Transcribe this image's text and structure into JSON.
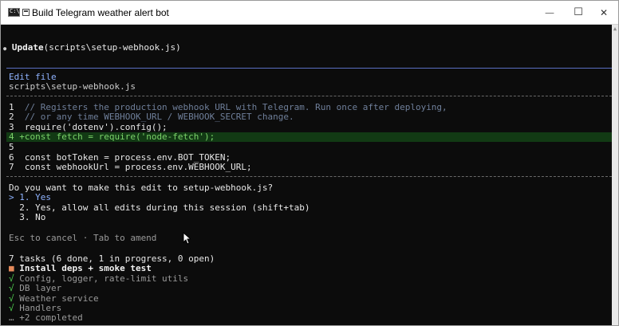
{
  "window": {
    "title": "Build Telegram weather alert bot",
    "app_icon_text": "C:\\",
    "controls": {
      "minimize": "—",
      "maximize": "☐",
      "close": "✕"
    }
  },
  "terminal": {
    "update_bullet": "●",
    "update_command": "Update",
    "update_arg": "(scripts\\setup-webhook.js)",
    "edit_header": "Edit file",
    "edit_path": "scripts\\setup-webhook.js",
    "code_lines": [
      {
        "num": "1",
        "marker": " ",
        "text": "// Registers the production webhook URL with Telegram. Run once after deploying,",
        "kind": "comment"
      },
      {
        "num": "2",
        "marker": " ",
        "text": "// or any time WEBHOOK_URL / WEBHOOK_SECRET change.",
        "kind": "comment"
      },
      {
        "num": "3",
        "marker": " ",
        "text": "require('dotenv').config();",
        "kind": "code"
      },
      {
        "num": "4",
        "marker": "+",
        "text": "const fetch = require('node-fetch');",
        "kind": "added"
      },
      {
        "num": "5",
        "marker": " ",
        "text": "",
        "kind": "code"
      },
      {
        "num": "6",
        "marker": " ",
        "text": "const botToken = process.env.BOT_TOKEN;",
        "kind": "code"
      },
      {
        "num": "7",
        "marker": " ",
        "text": "const webhookUrl = process.env.WEBHOOK_URL;",
        "kind": "code"
      }
    ],
    "question": "Do you want to make this edit to setup-webhook.js?",
    "options": [
      {
        "prefix": "> ",
        "label": "1. Yes",
        "selected": true
      },
      {
        "prefix": "  ",
        "label": "2. Yes, allow all edits during this session (shift+tab)",
        "selected": false
      },
      {
        "prefix": "  ",
        "label": "3. No",
        "selected": false
      }
    ],
    "hint": "Esc to cancel · Tab to amend",
    "tasks_summary": "7 tasks (6 done, 1 in progress, 0 open)",
    "tasks": [
      {
        "mark": "■",
        "label": "Install deps + smoke test",
        "status": "in_progress"
      },
      {
        "mark": "√",
        "label": "Config, logger, rate-limit utils",
        "status": "done"
      },
      {
        "mark": "√",
        "label": "DB layer",
        "status": "done"
      },
      {
        "mark": "√",
        "label": "Weather service",
        "status": "done"
      },
      {
        "mark": "√",
        "label": "Handlers",
        "status": "done"
      }
    ],
    "more_completed": "… +2 completed"
  }
}
